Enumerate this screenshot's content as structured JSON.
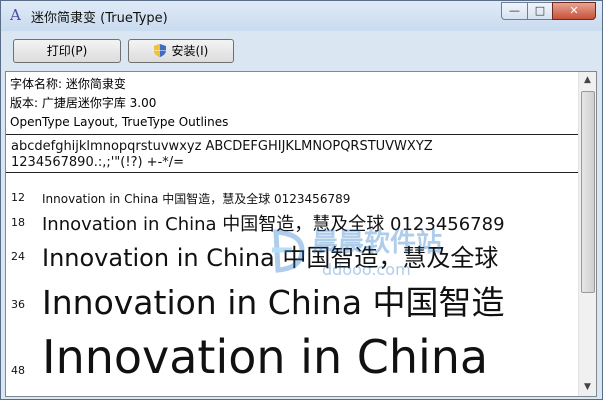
{
  "window": {
    "title": "迷你简隶变 (TrueType)",
    "controls": {
      "minimize": "—",
      "maximize": "□",
      "close": "✕"
    }
  },
  "toolbar": {
    "print_label": "打印(P)",
    "install_label": "安装(I)"
  },
  "info": {
    "font_name": "字体名称: 迷你简隶变",
    "version": "版本: 广捷居迷你字库 3.00",
    "format": "OpenType Layout, TrueType Outlines"
  },
  "charset": {
    "line1": "abcdefghijklmnopqrstuvwxyz ABCDEFGHIJKLMNOPQRSTUVWXYZ",
    "line2": "1234567890.:,;'\"(!?) +-*/="
  },
  "samples": [
    {
      "size": "12",
      "text": "Innovation in China 中国智造，慧及全球 0123456789"
    },
    {
      "size": "18",
      "text": "Innovation in China 中国智造，慧及全球 0123456789"
    },
    {
      "size": "24",
      "text": "Innovation in China 中国智造，慧及全球"
    },
    {
      "size": "36",
      "text": "Innovation in China 中国智造"
    },
    {
      "size": "48",
      "text": "Innovation in China"
    }
  ],
  "watermark": {
    "text": "晨晨软件站",
    "url": "ddooo.com"
  },
  "icons": [
    "app-icon",
    "shield-icon",
    "scroll-up-icon",
    "scroll-down-icon"
  ],
  "colors": {
    "titlebar": "#c9dbef",
    "close": "#c7513a",
    "watermark": "#1d72c8"
  }
}
